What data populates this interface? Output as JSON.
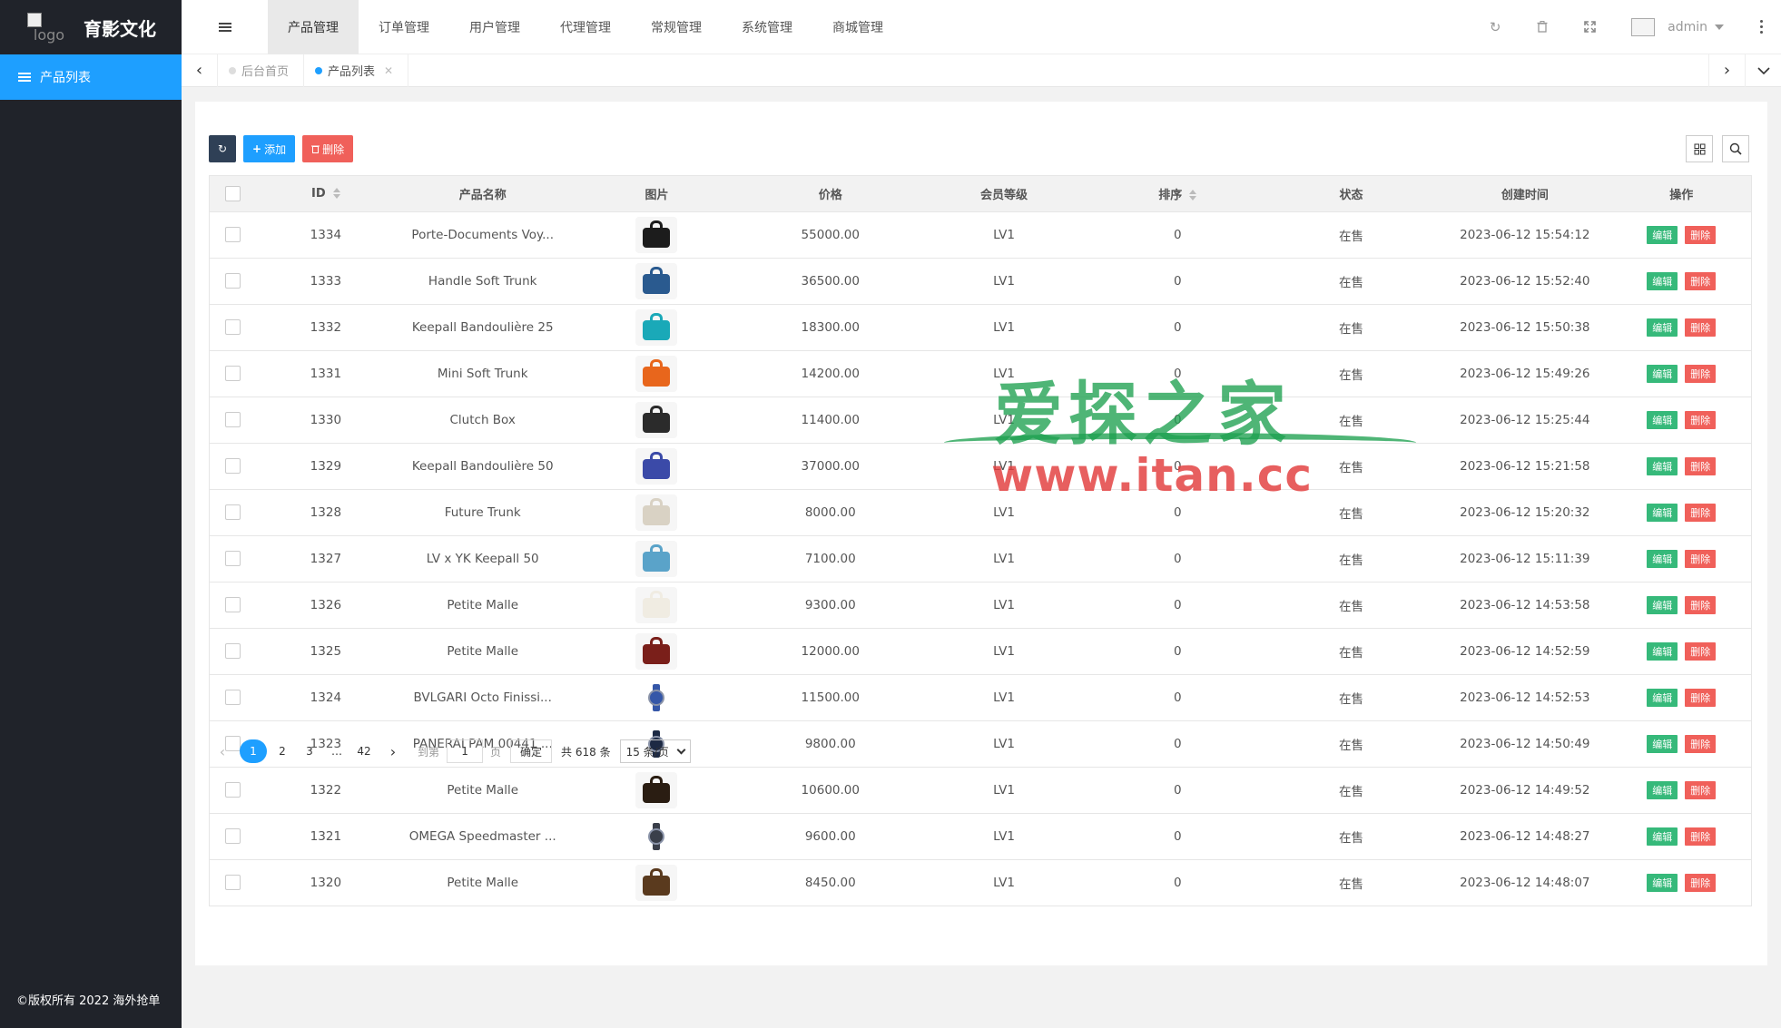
{
  "sidebar": {
    "logo_alt": "logo",
    "title": "育影文化",
    "items": [
      {
        "label": "产品列表"
      }
    ],
    "copyright": "©版权所有 2022 海外抢单"
  },
  "header": {
    "nav": [
      "产品管理",
      "订单管理",
      "用户管理",
      "代理管理",
      "常规管理",
      "系统管理",
      "商城管理"
    ],
    "active_nav": "产品管理",
    "user": "admin"
  },
  "tabs": [
    {
      "label": "后台首页",
      "active": false
    },
    {
      "label": "产品列表",
      "active": true
    }
  ],
  "toolbar": {
    "add_label": "添加",
    "delete_label": "删除"
  },
  "table": {
    "columns": [
      "ID",
      "产品名称",
      "图片",
      "价格",
      "会员等级",
      "排序",
      "状态",
      "创建时间",
      "操作"
    ],
    "rows": [
      {
        "id": "1334",
        "name": "Porte-Documents Voy...",
        "price": "55000.00",
        "level": "LV1",
        "sort": "0",
        "status": "在售",
        "created": "2023-06-12 15:54:12",
        "img_color": "#1c1c1c"
      },
      {
        "id": "1333",
        "name": "Handle Soft Trunk",
        "price": "36500.00",
        "level": "LV1",
        "sort": "0",
        "status": "在售",
        "created": "2023-06-12 15:52:40",
        "img_color": "#2a5a8f"
      },
      {
        "id": "1332",
        "name": "Keepall Bandoulière 25",
        "price": "18300.00",
        "level": "LV1",
        "sort": "0",
        "status": "在售",
        "created": "2023-06-12 15:50:38",
        "img_color": "#1aa9b8"
      },
      {
        "id": "1331",
        "name": "Mini Soft Trunk",
        "price": "14200.00",
        "level": "LV1",
        "sort": "0",
        "status": "在售",
        "created": "2023-06-12 15:49:26",
        "img_color": "#e8661c"
      },
      {
        "id": "1330",
        "name": "Clutch Box",
        "price": "11400.00",
        "level": "LV1",
        "sort": "0",
        "status": "在售",
        "created": "2023-06-12 15:25:44",
        "img_color": "#2b2b2b"
      },
      {
        "id": "1329",
        "name": "Keepall Bandoulière 50",
        "price": "37000.00",
        "level": "LV1",
        "sort": "0",
        "status": "在售",
        "created": "2023-06-12 15:21:58",
        "img_color": "#3b4aa8"
      },
      {
        "id": "1328",
        "name": "Future Trunk",
        "price": "8000.00",
        "level": "LV1",
        "sort": "0",
        "status": "在售",
        "created": "2023-06-12 15:20:32",
        "img_color": "#d9d2c4"
      },
      {
        "id": "1327",
        "name": "LV x YK Keepall 50",
        "price": "7100.00",
        "level": "LV1",
        "sort": "0",
        "status": "在售",
        "created": "2023-06-12 15:11:39",
        "img_color": "#5aa3c9"
      },
      {
        "id": "1326",
        "name": "Petite Malle",
        "price": "9300.00",
        "level": "LV1",
        "sort": "0",
        "status": "在售",
        "created": "2023-06-12 14:53:58",
        "img_color": "#f0ece2"
      },
      {
        "id": "1325",
        "name": "Petite Malle",
        "price": "12000.00",
        "level": "LV1",
        "sort": "0",
        "status": "在售",
        "created": "2023-06-12 14:52:59",
        "img_color": "#7a1f1a"
      },
      {
        "id": "1324",
        "name": "BVLGARI Octo Finissi...",
        "price": "11500.00",
        "level": "LV1",
        "sort": "0",
        "status": "在售",
        "created": "2023-06-12 14:52:53",
        "img_color": "#3557a8",
        "watch": true
      },
      {
        "id": "1323",
        "name": "PANERAI PAM 00441 ...",
        "price": "9800.00",
        "level": "LV1",
        "sort": "0",
        "status": "在售",
        "created": "2023-06-12 14:50:49",
        "img_color": "#1d2a44",
        "watch": true
      },
      {
        "id": "1322",
        "name": "Petite Malle",
        "price": "10600.00",
        "level": "LV1",
        "sort": "0",
        "status": "在售",
        "created": "2023-06-12 14:49:52",
        "img_color": "#2a1d12"
      },
      {
        "id": "1321",
        "name": "OMEGA Speedmaster ...",
        "price": "9600.00",
        "level": "LV1",
        "sort": "0",
        "status": "在售",
        "created": "2023-06-12 14:48:27",
        "img_color": "#3a3f4a",
        "watch": true
      },
      {
        "id": "1320",
        "name": "Petite Malle",
        "price": "8450.00",
        "level": "LV1",
        "sort": "0",
        "status": "在售",
        "created": "2023-06-12 14:48:07",
        "img_color": "#5a3a1e"
      }
    ],
    "edit_label": "编辑",
    "delete_label": "删除"
  },
  "pagination": {
    "pages": [
      "1",
      "2",
      "3"
    ],
    "ellipsis": "…",
    "last_page": "42",
    "current": "1",
    "goto_label": "到第",
    "goto_value": "1",
    "page_unit": "页",
    "confirm_label": "确定",
    "total_label": "共 618 条",
    "page_size": "15 条/页"
  },
  "watermark": {
    "line1": "爱探之家",
    "line2": "www.itan.cc"
  }
}
